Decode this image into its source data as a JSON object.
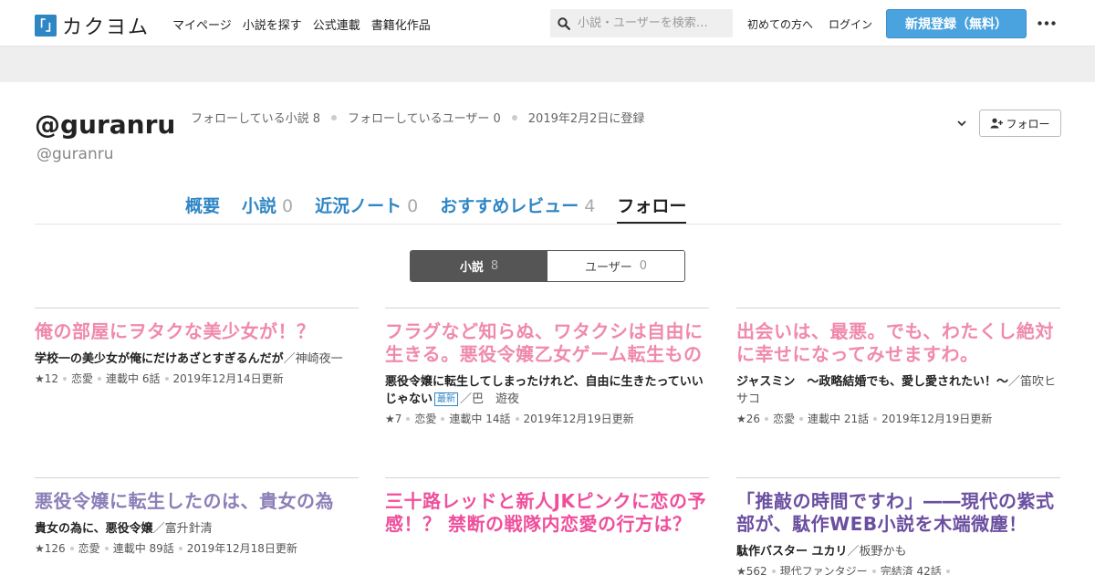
{
  "header": {
    "logo_mark": "「」",
    "logo_text": "カクヨム",
    "nav": [
      "マイページ",
      "小説を探す",
      "公式連載",
      "書籍化作品"
    ],
    "search_placeholder": "小説・ユーザーを検索…",
    "first_time": "初めての方へ",
    "login": "ログイン",
    "signup": "新規登録（無料）",
    "accent": "#4aa3df"
  },
  "profile": {
    "display_name": "@guranru",
    "screen_name": "@guranru",
    "stats": {
      "following_novels": "フォローしている小説 8",
      "following_users": "フォローしているユーザー 0",
      "registered": "2019年2月2日に登録"
    },
    "follow_button": "フォロー"
  },
  "tabs": [
    {
      "label": "概要",
      "count": ""
    },
    {
      "label": "小説",
      "count": "0"
    },
    {
      "label": "近況ノート",
      "count": "0"
    },
    {
      "label": "おすすめレビュー",
      "count": "4"
    },
    {
      "label": "フォロー",
      "count": ""
    }
  ],
  "segment": {
    "novels_label": "小説",
    "novels_count": "8",
    "users_label": "ユーザー",
    "users_count": "0"
  },
  "cards": [
    {
      "title": "俺の部屋にヲタクな美少女が！？",
      "title_color": "#f08aad",
      "catch": "学校一の美少女が俺にだけあざとすぎるんだが",
      "author": "／神崎夜一",
      "new": "",
      "stars": "★12",
      "genre": "恋愛",
      "status": "連載中 6話",
      "updated": "2019年12月14日更新"
    },
    {
      "title": "フラグなど知らぬ、ワタクシは自由に生きる。悪役令嬢乙女ゲーム転生もの",
      "title_color": "#f08aad",
      "catch": "悪役令嬢に転生してしまったけれど、自由に生きたっていいじゃない",
      "author": "／巴　遊夜",
      "new": "最新",
      "stars": "★7",
      "genre": "恋愛",
      "status": "連載中 14話",
      "updated": "2019年12月19日更新"
    },
    {
      "title": "出会いは、最悪。でも、わたくし絶対に幸せになってみせますわ。",
      "title_color": "#f08aad",
      "catch": "ジャスミン　〜政略結婚でも、愛し愛されたい！〜",
      "author": "／笛吹ヒサコ",
      "new": "",
      "stars": "★26",
      "genre": "恋愛",
      "status": "連載中 21話",
      "updated": "2019年12月19日更新"
    },
    {
      "title": "悪役令嬢に転生したのは、貴女の為",
      "title_color": "#8c7fb8",
      "catch": "貴女の為に、悪役令嬢",
      "author": "／富升針清",
      "new": "",
      "stars": "★126",
      "genre": "恋愛",
      "status": "連載中 89話",
      "updated": "2019年12月18日更新"
    },
    {
      "title": "三十路レッドと新人JKピンクに恋の予感！？ 禁断の戦隊内恋愛の行方は？",
      "title_color": "#ef4f9c",
      "catch": "",
      "author": "",
      "new": "",
      "stars": "",
      "genre": "",
      "status": "",
      "updated": ""
    },
    {
      "title": "「推敲の時間ですわ」――現代の紫式部が、駄作WEB小説を木端微塵！",
      "title_color": "#6a4fa0",
      "catch": "駄作バスター ユカリ",
      "author": "／板野かも",
      "new": "",
      "stars": "★562",
      "genre": "現代ファンタジー",
      "status": "完結済 42話",
      "updated": ""
    }
  ]
}
